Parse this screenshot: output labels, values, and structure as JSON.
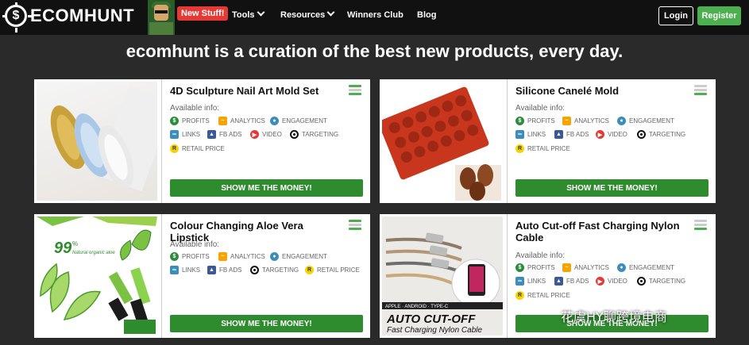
{
  "nav": {
    "logo_symbol": "$",
    "logo": "ECOMHUNT",
    "badge": "New Stuff!",
    "items": [
      {
        "label": "Tools",
        "dropdown": true
      },
      {
        "label": "Resources",
        "dropdown": true
      },
      {
        "label": "Winners Club",
        "dropdown": false
      },
      {
        "label": "Blog",
        "dropdown": false
      }
    ],
    "login": "Login",
    "register": "Register"
  },
  "headline": "ecomhunt is a curation of the best new products, every day.",
  "available_label": "Available info:",
  "money_label": "SHOW ME THE MONEY!",
  "features": {
    "profits": "PROFITS",
    "analytics": "ANALYTICS",
    "engagement": "ENGAGEMENT",
    "links": "LINKS",
    "fbads": "FB ADS",
    "video": "VIDEO",
    "targeting": "TARGETING",
    "retail": "RETAIL PRICE"
  },
  "products": [
    {
      "title": "4D Sculpture Nail Art Mold Set",
      "meter_level": 2
    },
    {
      "title": "Silicone Canelé Mold",
      "meter_level": 1
    },
    {
      "title": "Colour Changing Aloe Vera Lipstick",
      "meter_level": 2,
      "img_text_main": "99",
      "img_text_pct": "%",
      "img_text_sub": "Natural organic aloe"
    },
    {
      "title": "Auto Cut-off Fast Charging Nylon Cable",
      "meter_level": 1,
      "img_tag": "APPLE · ANDROID · TYPE-C",
      "img_headline": "AUTO CUT-OFF",
      "img_sub": "Fast Charging Nylon Cable"
    }
  ],
  "watermark": "花虞HY聊跨境电商",
  "colors": {
    "accent_green": "#4caf50",
    "money_green": "#2e8b2e",
    "badge_red": "#e53935"
  }
}
